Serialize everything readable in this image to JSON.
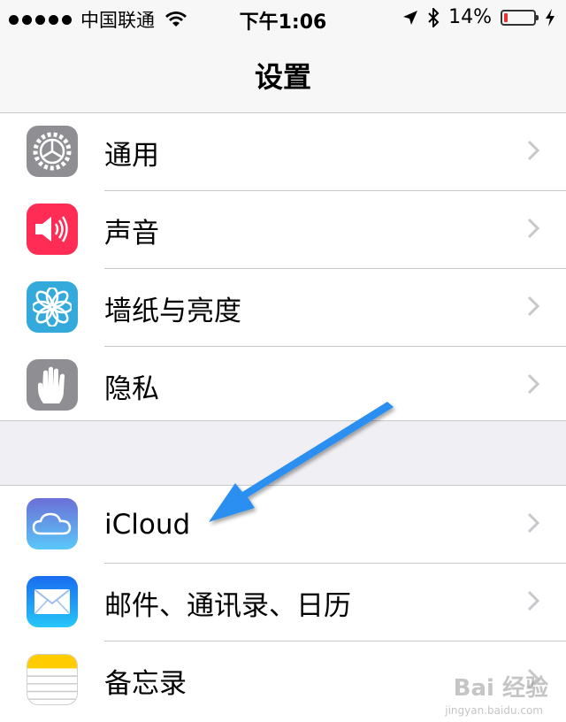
{
  "status_bar": {
    "carrier": "中国联通",
    "time": "下午1:06",
    "battery_text": "14%",
    "battery_level": 0.14
  },
  "nav": {
    "title": "设置"
  },
  "groups": [
    {
      "items": [
        {
          "label": "通用",
          "icon": "gear-icon",
          "color": "#8e8e93"
        },
        {
          "label": "声音",
          "icon": "speaker-icon",
          "color": "#ff2d55"
        },
        {
          "label": "墙纸与亮度",
          "icon": "flower-icon",
          "color": "#34aadc"
        },
        {
          "label": "隐私",
          "icon": "hand-icon",
          "color": "#8e8e93"
        }
      ]
    },
    {
      "items": [
        {
          "label": "iCloud",
          "icon": "cloud-icon",
          "color": "#5ac8fa"
        },
        {
          "label": "邮件、通讯录、日历",
          "icon": "envelope-icon",
          "color": "#1a8cff"
        },
        {
          "label": "备忘录",
          "icon": "notes-icon",
          "color": "#ffcc00"
        }
      ]
    }
  ],
  "annotation": {
    "arrow_color": "#2b8ff0"
  },
  "watermark": {
    "text": "Bai 经验",
    "sub": "jingyan.baidu.com"
  }
}
